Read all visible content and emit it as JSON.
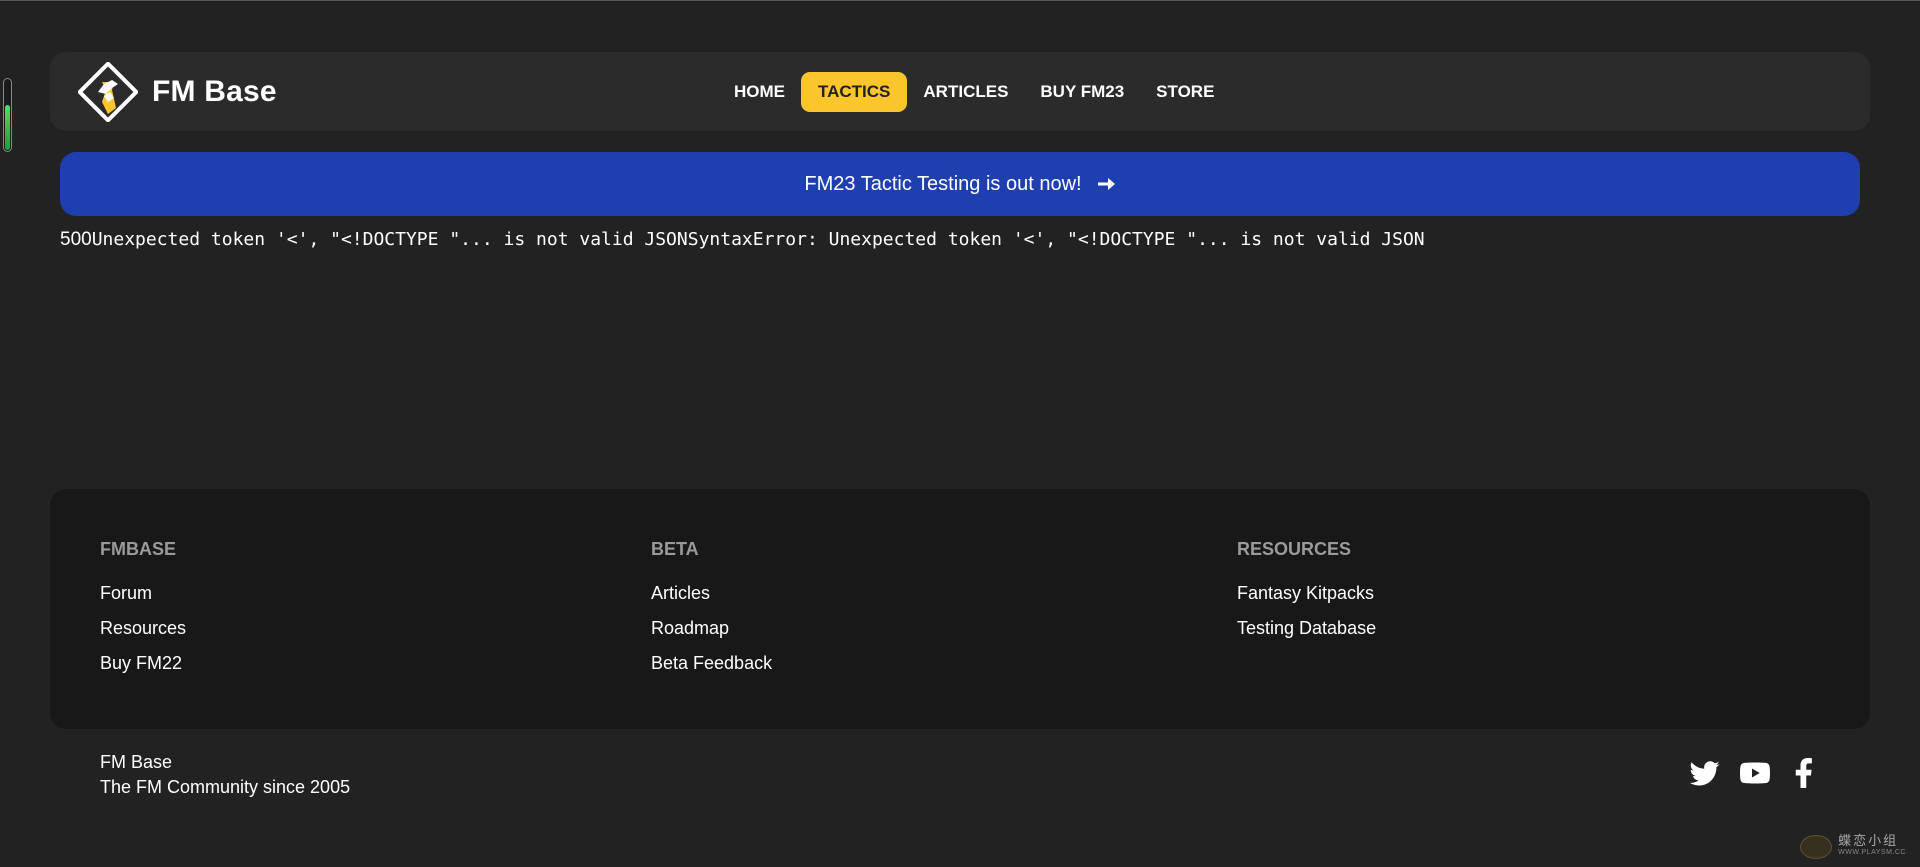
{
  "site": {
    "name": "FM Base"
  },
  "nav": {
    "items": [
      {
        "label": "HOME",
        "active": false
      },
      {
        "label": "TACTICS",
        "active": true
      },
      {
        "label": "ARTICLES",
        "active": false
      },
      {
        "label": "BUY FM23",
        "active": false
      },
      {
        "label": "STORE",
        "active": false
      }
    ]
  },
  "banner": {
    "text": "FM23 Tactic Testing is out now!",
    "icon": "arrow-right-icon",
    "color": "#1f3fb0"
  },
  "error": {
    "code": "500",
    "message": "Unexpected token '<', \"<!DOCTYPE \"... is not valid JSONSyntaxError: Unexpected token '<', \"<!DOCTYPE \"... is not valid JSON"
  },
  "footer": {
    "columns": [
      {
        "heading": "FMBASE",
        "links": [
          "Forum",
          "Resources",
          "Buy FM22"
        ]
      },
      {
        "heading": "BETA",
        "links": [
          "Articles",
          "Roadmap",
          "Beta Feedback"
        ]
      },
      {
        "heading": "RESOURCES",
        "links": [
          "Fantasy Kitpacks",
          "Testing Database"
        ]
      }
    ],
    "brand": "FM Base",
    "tagline": "The FM Community since 2005",
    "social": [
      "twitter-icon",
      "youtube-icon",
      "facebook-icon"
    ]
  },
  "watermark": {
    "main": "蝶恋小组",
    "sub": "WWW.PLAYSM.CC"
  },
  "colors": {
    "accent": "#fbc62c",
    "background": "#222222",
    "header": "#2b2b2b",
    "footer": "#181818",
    "banner": "#1f3fb0"
  }
}
